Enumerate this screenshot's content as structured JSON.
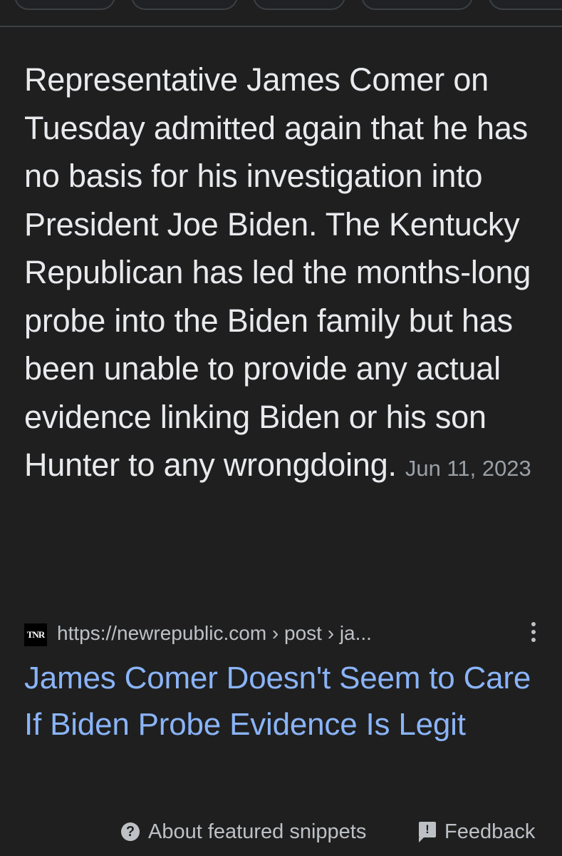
{
  "snippet": {
    "text": "Representative James Comer on Tuesday admitted again that he has no basis for his investigation into President Joe Biden. The Kentucky Republican has led the months-long probe into the Biden family but has been unable to provide any actual evidence linking Biden or his son Hunter to any wrongdoing.",
    "date": "Jun 11, 2023"
  },
  "source": {
    "favicon_text": "TNR",
    "url": "https://newrepublic.com › post › ja...",
    "more_icon": "more-vert-icon"
  },
  "result": {
    "title": "James Comer Doesn't Seem to Care If Biden Probe Evidence Is Legit"
  },
  "footer": {
    "about_label": "About featured snippets",
    "about_icon": "help-circle-icon",
    "feedback_label": "Feedback",
    "feedback_icon": "feedback-icon"
  },
  "colors": {
    "background": "#1f1f1f",
    "text": "#e8eaed",
    "secondary_text": "#9aa0a6",
    "link": "#8ab4f8"
  }
}
